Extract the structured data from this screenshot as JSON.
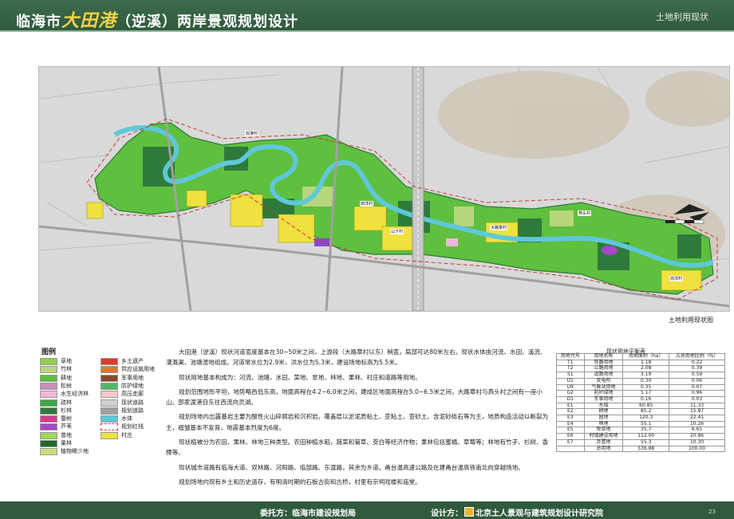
{
  "header": {
    "title_prefix": "临海市",
    "title_big": "大田港",
    "title_suffix": "（逆溪）两岸景观规划设计",
    "section": "土地利用现状"
  },
  "map": {
    "caption": "土地利用现状图",
    "labels": [
      "双港村",
      "田洋村",
      "山下村",
      "大路章村",
      "燕头村",
      "前洋村"
    ]
  },
  "legend": {
    "title": "图例",
    "items": [
      {
        "label": "草地",
        "color": "#8fcf4a"
      },
      {
        "label": "竹林",
        "color": "#b7d67c"
      },
      {
        "label": "耕地",
        "color": "#5fbf3f"
      },
      {
        "label": "松树",
        "color": "#c98fb8"
      },
      {
        "label": "水生经济林",
        "color": "#f0b8d8"
      },
      {
        "label": "疏林",
        "color": "#3fa84a"
      },
      {
        "label": "杉林",
        "color": "#2e7a3a"
      },
      {
        "label": "蚕树",
        "color": "#d63a8c"
      },
      {
        "label": "芦苇",
        "color": "#a846c8"
      },
      {
        "label": "苗地",
        "color": "#9fd65a"
      },
      {
        "label": "果林",
        "color": "#1f6a2a"
      },
      {
        "label": "植物稀少地",
        "color": "#c8e07a"
      },
      {
        "label": "乡土遗产",
        "color": "#e03a2a"
      },
      {
        "label": "供应设施用地",
        "color": "#e0792a"
      },
      {
        "label": "军事用地",
        "color": "#8a4a2a"
      },
      {
        "label": "防护绿地",
        "color": "#50b868"
      },
      {
        "label": "高压走廊",
        "color": "#f2c8c8"
      },
      {
        "label": "现状道路",
        "color": "#cfcfcf"
      },
      {
        "label": "规划道路",
        "color": "#a0a0a0"
      },
      {
        "label": "水体",
        "color": "#5fc8d8"
      },
      {
        "label": "规划红线",
        "color": "#c83a3a"
      },
      {
        "label": "村庄",
        "color": "#f0e040"
      }
    ]
  },
  "description": [
    "大田港（逆溪）现状河道宽度基本在30~50米之间，上游段（大路章村以东）稍宽，局部可达80米左右。现状水体由河流、水田、溪流、灌溉渠、池塘湿地组成。河道常水位为2.9米，洪水位为5.3米，建设场地标高为5.5米。",
    "现状用地基本构成为：河流、池塘、水田、菜地、旱地、林地、果林、村庄和道路等用地。",
    "规划范围地形平坦，地势略西低东高，地面高程在4.2~6.0米之间，建成区地面高程在5.0~6.5米之间，大路章村与燕头村之间有一座小山。邵家渡港自东往西流向灵湖。",
    "规划场地内出露基岩主要为酸性火山碎屑岩和沉积岩。覆盖层以淤泥质粘土、亚粘土、亚砂土、含泥砂砾石等为主，地质构造活动以断裂为主，褶皱基本不发育，地震基本烈度为6度。",
    "现状植被分为农田、果林、林地三种类型。农田种植水稻，蔬菜和菊草、茭白等经济作物；果林包括蜜橘、草莓等；林地有竹子、杉树、香樟等。",
    "现状城市道路有临海大道、双林路、河阳路、临部路、东渡路，其余为乡道。甬台温高速公路及在建甬台温高铁南北向穿越场地。",
    "规划场地内现有乡土和历史遗存，有明清时期的石板古街和古桥，村里有宗祠戏楼和庙堂。"
  ],
  "table": {
    "title": "现状用地平衡表",
    "headers": [
      "用地代号",
      "用地名称",
      "用地面积（ha）",
      "占总用地比例（%）"
    ],
    "rows": [
      [
        "T1",
        "铁路用地",
        "1.18",
        "0.22"
      ],
      [
        "T2",
        "公路用地",
        "2.08",
        "0.39"
      ],
      [
        "S1",
        "道路用地",
        "3.19",
        "0.59"
      ],
      [
        "U1",
        "变电所",
        "0.30",
        "0.06"
      ],
      [
        "U9",
        "气象站用地",
        "0.35",
        "0.07"
      ],
      [
        "G2",
        "防护绿地",
        "5.17",
        "0.96"
      ],
      [
        "D1",
        "军事用地",
        "0.16",
        "0.03"
      ],
      [
        "E1",
        "水域",
        "60.85",
        "11.33"
      ],
      [
        "E2",
        "耕地",
        "85.2",
        "15.87"
      ],
      [
        "E3",
        "园地",
        "120.3",
        "22.41"
      ],
      [
        "E4",
        "林地",
        "55.1",
        "10.26"
      ],
      [
        "E5",
        "牧草地",
        "35.7",
        "6.65"
      ],
      [
        "E6",
        "村镇建设用地",
        "112.00",
        "20.86"
      ],
      [
        "E7",
        "弃置地",
        "55.3",
        "10.30"
      ],
      [
        "",
        "总用地",
        "536.88",
        "100.00"
      ]
    ]
  },
  "footer": {
    "client_label": "委托方：临海市建设规划局",
    "design_label": "设计方：",
    "design_org": "北京土人景观与建筑规划设计研究院",
    "page": "23"
  }
}
